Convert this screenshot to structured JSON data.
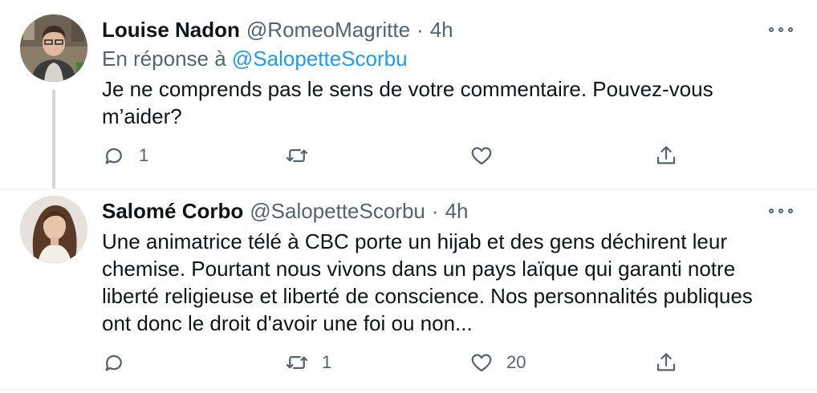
{
  "tweets": [
    {
      "author_name": "Louise Nadon",
      "handle": "@RomeoMagritte",
      "separator": "·",
      "time": "4h",
      "reply_prefix": "En réponse à",
      "reply_to": "@SalopetteScorbu",
      "text": "Je ne comprends pas le sens de votre commentaire. Pouvez-vous\nm’aider?",
      "reply_count": "1",
      "retweet_count": "",
      "like_count": ""
    },
    {
      "author_name": "Salomé Corbo",
      "handle": "@SalopetteScorbu",
      "separator": "·",
      "time": "4h",
      "text": "Une animatrice télé à CBC porte un hijab et des gens déchirent leur\nchemise. Pourtant nous vivons dans un pays laïque qui garanti notre\nliberté religieuse et liberté de conscience. Nos personnalités publiques\nont donc le droit d'avoir une foi ou non...",
      "reply_count": "",
      "retweet_count": "1",
      "like_count": "20"
    }
  ],
  "icons": {
    "reply": "reply-icon",
    "retweet": "retweet-icon",
    "like": "heart-icon",
    "share": "share-icon",
    "more": "more-icon"
  },
  "colors": {
    "accent": "#1d9bf0",
    "secondary_text": "#536471",
    "primary_text": "#0f1419",
    "thread_line": "#cfd9de"
  }
}
